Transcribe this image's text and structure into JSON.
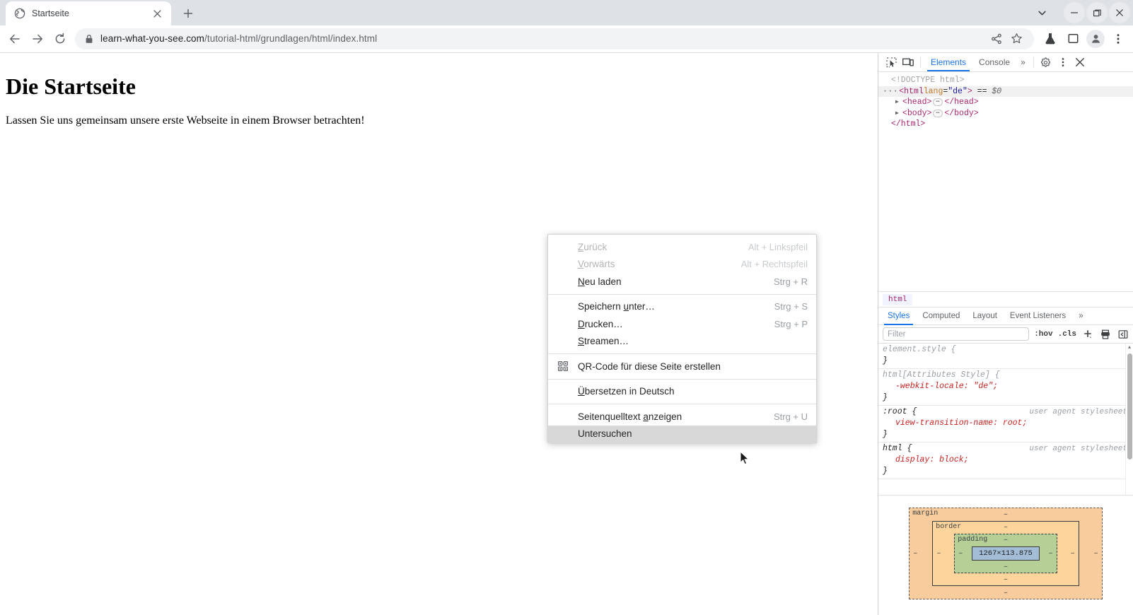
{
  "window": {
    "controls": [
      {
        "name": "tab-search-button",
        "icon": "chevron-down-icon",
        "label": "Tabsuche"
      },
      {
        "name": "minimize-button",
        "icon": "minimize-icon",
        "label": "Minimieren"
      },
      {
        "name": "maximize-button",
        "icon": "restore-icon",
        "label": "Maximieren"
      },
      {
        "name": "close-button",
        "icon": "close-icon",
        "label": "Schließen"
      }
    ]
  },
  "tabstrip": {
    "tabs": [
      {
        "title": "Startseite",
        "favicon": "globe-icon",
        "close_label": "×",
        "active": true
      }
    ],
    "new_tab_label": "+"
  },
  "toolbar": {
    "back_label": "←",
    "forward_label": "→",
    "reload_label": "⟳",
    "url_host": "learn-what-you-see.com",
    "url_path": "/tutorial-html/grundlagen/html/index.html",
    "url_full": "learn-what-you-see.com/tutorial-html/grundlagen/html/index.html",
    "lock_icon": "lock-icon",
    "actions": [
      {
        "name": "share-button",
        "icon": "share-icon"
      },
      {
        "name": "bookmark-button",
        "icon": "star-icon"
      },
      {
        "name": "experiments-button",
        "icon": "flask-icon"
      },
      {
        "name": "side-panel-button",
        "icon": "side-panel-icon"
      },
      {
        "name": "profile-button",
        "icon": "person-icon"
      },
      {
        "name": "chrome-menu-button",
        "icon": "kebab-menu-icon"
      }
    ]
  },
  "page": {
    "heading": "Die Startseite",
    "paragraph": "Lassen Sie uns gemeinsam unsere erste Webseite in einem Browser betrachten!"
  },
  "context_menu": {
    "groups": [
      {
        "items": [
          {
            "label": "Zurück",
            "accel": "Alt + Linkspfeil",
            "disabled": true,
            "underline": "Z",
            "icon": null
          },
          {
            "label": "Vorwärts",
            "accel": "Alt + Rechtspfeil",
            "disabled": true,
            "underline": "V",
            "icon": null
          },
          {
            "label": "Neu laden",
            "accel": "Strg + R",
            "disabled": false,
            "underline": "N",
            "icon": null
          }
        ]
      },
      {
        "items": [
          {
            "label": "Speichern unter…",
            "accel": "Strg + S",
            "disabled": false,
            "underline": "u",
            "icon": null
          },
          {
            "label": "Drucken…",
            "accel": "Strg + P",
            "disabled": false,
            "underline": "D",
            "icon": null
          },
          {
            "label": "Streamen…",
            "accel": "",
            "disabled": false,
            "underline": "S",
            "icon": null
          }
        ]
      },
      {
        "items": [
          {
            "label": "QR-Code für diese Seite erstellen",
            "accel": "",
            "disabled": false,
            "underline": "",
            "icon": "qr-code-icon"
          }
        ]
      },
      {
        "items": [
          {
            "label": "Übersetzen in Deutsch",
            "accel": "",
            "disabled": false,
            "underline": "Ü",
            "icon": null
          }
        ]
      },
      {
        "items": [
          {
            "label": "Seitenquelltext anzeigen",
            "accel": "Strg + U",
            "disabled": false,
            "underline": "a",
            "icon": null
          },
          {
            "label": "Untersuchen",
            "accel": "",
            "disabled": false,
            "underline": "",
            "icon": null,
            "selected": true
          }
        ]
      }
    ]
  },
  "devtools": {
    "topbar": {
      "inspect_icon": "inspect-element-icon",
      "device_icon": "device-toolbar-icon",
      "tabs": [
        {
          "label": "Elements",
          "active": true
        },
        {
          "label": "Console",
          "active": false
        }
      ],
      "more_tabs_label": "»",
      "settings_icon": "gear-icon",
      "menu_icon": "kebab-menu-icon",
      "close_icon": "close-icon"
    },
    "elements_tree": [
      {
        "indent": 0,
        "prefix": "",
        "triangle": "",
        "text": "<!DOCTYPE html>",
        "kind": "doctype",
        "selected": false
      },
      {
        "indent": 0,
        "prefix": "···",
        "triangle": "",
        "text": "<html lang=\"de\">",
        "suffix": "== $0",
        "kind": "element",
        "selected": true
      },
      {
        "indent": 1,
        "prefix": "",
        "triangle": "▶",
        "text": "<head>",
        "badge": "…",
        "close": "</head>",
        "kind": "element",
        "selected": false
      },
      {
        "indent": 1,
        "prefix": "",
        "triangle": "▶",
        "text": "<body>",
        "badge": "…",
        "close": "</body>",
        "kind": "element",
        "selected": false
      },
      {
        "indent": 1,
        "prefix": "",
        "triangle": "",
        "text": "</html>",
        "kind": "element",
        "selected": false
      }
    ],
    "breadcrumb": [
      "html"
    ],
    "style_tabs": [
      {
        "label": "Styles",
        "active": true
      },
      {
        "label": "Computed",
        "active": false
      },
      {
        "label": "Layout",
        "active": false
      },
      {
        "label": "Event Listeners",
        "active": false
      }
    ],
    "style_tabs_more": "»",
    "filter": {
      "value": "",
      "placeholder": "Filter",
      "hov_label": ":hov",
      "cls_label": ".cls",
      "add_rule_icon": "plus-icon",
      "class_icon": "print-style-icon",
      "sidebar_icon": "toggle-sidebar-icon"
    },
    "css_rules": [
      {
        "selector": "element.style {",
        "muted": true,
        "origin": "",
        "declarations": [],
        "close": "}"
      },
      {
        "selector": "html[Attributes Style] {",
        "muted": true,
        "origin": "",
        "declarations": [
          {
            "property": "-webkit-locale",
            "value": "\"de\";"
          }
        ],
        "close": "}"
      },
      {
        "selector": ":root {",
        "muted": false,
        "origin": "user agent stylesheet",
        "declarations": [
          {
            "property": "view-transition-name",
            "value": "root;"
          }
        ],
        "close": "}"
      },
      {
        "selector": "html {",
        "muted": false,
        "origin": "user agent stylesheet",
        "declarations": [
          {
            "property": "display",
            "value": "block;"
          }
        ],
        "close": "}"
      }
    ],
    "box_model": {
      "margin_label": "margin",
      "border_label": "border",
      "padding_label": "padding",
      "content_size": "1267×113.875",
      "margin_top": "–",
      "margin_right": "–",
      "margin_bottom": "–",
      "margin_left": "–",
      "border_top": "–",
      "border_right": "–",
      "border_bottom": "–",
      "border_left": "–",
      "padding_top": "–",
      "padding_right": "–",
      "padding_bottom": "–",
      "padding_left": "–",
      "colors": {
        "margin": "#f9cc9d",
        "border": "#fdd49b",
        "padding": "#b5cf97",
        "content": "#a3bdd6"
      }
    }
  },
  "theme": {
    "accent": "#1a73e8",
    "tabstrip_bg": "#dee1e6",
    "omnibox_bg": "#f1f3f4",
    "menu_selected_bg": "#d8d8d8"
  }
}
